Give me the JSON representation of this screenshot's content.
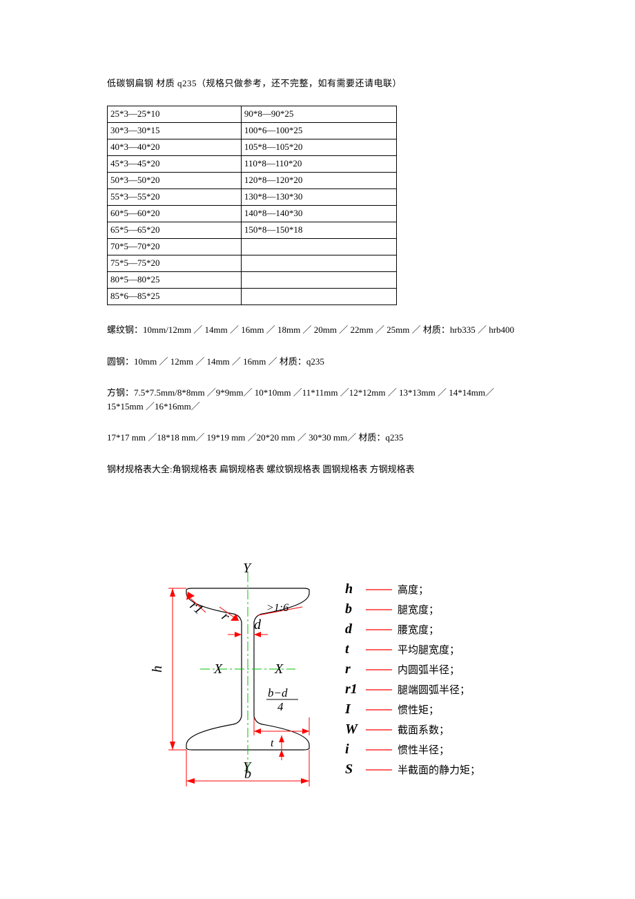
{
  "title": "低碳钢扁钢 材质 q235（规格只做参考，还不完整，如有需要还请电联）",
  "table": {
    "rows": [
      [
        "25*3—25*10",
        "90*8—90*25"
      ],
      [
        "30*3—30*15",
        "100*6—100*25"
      ],
      [
        "40*3—40*20",
        "105*8—105*20"
      ],
      [
        "45*3—45*20",
        "110*8—110*20"
      ],
      [
        "50*3—50*20",
        "120*8—120*20"
      ],
      [
        "55*3—55*20",
        "130*8—130*30"
      ],
      [
        "60*5—60*20",
        "140*8—140*30"
      ],
      [
        "65*5—65*20",
        "150*8—150*18"
      ],
      [
        "70*5—70*20",
        ""
      ],
      [
        "75*5—75*20",
        ""
      ],
      [
        "80*5—80*25",
        ""
      ],
      [
        "85*6—85*25",
        ""
      ]
    ]
  },
  "para1": "螺纹钢：10mm/12mm ／ 14mm ／ 16mm ／ 18mm ／ 20mm ／ 22mm ／ 25mm ／ 材质：hrb335 ／ hrb400",
  "para2": "圆钢：10mm ／ 12mm ／ 14mm ／ 16mm ／ 材质：q235",
  "para3": "方钢：7.5*7.5mm/8*8mm ／9*9mm／ 10*10mm ／11*11mm ／12*12mm ／ 13*13mm ／ 14*14mm／ 15*15mm ／16*16mm／",
  "para4": "17*17 mm ／18*18 mm／ 19*19 mm ／20*20 mm ／ 30*30 mm／ 材质：q235",
  "para5": "钢材规格表大全:角钢规格表 扁钢规格表 螺纹钢规格表 圆钢规格表 方钢规格表",
  "diagram": {
    "Y": "Y",
    "X": "X",
    "r1": "r1",
    "r": "r",
    "slope": ">1:6",
    "d": "d",
    "h": "h",
    "b": "b",
    "t": "t",
    "bd4_top": "b−d",
    "bd4_bot": "4",
    "legend": [
      {
        "sym": "h",
        "dash": "——",
        "cn": "高度；"
      },
      {
        "sym": "b",
        "dash": "——",
        "cn": "腿宽度；"
      },
      {
        "sym": "d",
        "dash": "——",
        "cn": "腰宽度；"
      },
      {
        "sym": "t",
        "dash": "——",
        "cn": "平均腿宽度；"
      },
      {
        "sym": "r",
        "dash": "——",
        "cn": "内圆弧半径；"
      },
      {
        "sym": "r1",
        "dash": "——",
        "cn": "腿端圆弧半径；"
      },
      {
        "sym": "I",
        "dash": "——",
        "cn": "惯性矩；"
      },
      {
        "sym": "W",
        "dash": "——",
        "cn": "截面系数；"
      },
      {
        "sym": "i",
        "dash": "——",
        "cn": "惯性半径；"
      },
      {
        "sym": "S",
        "dash": "——",
        "cn": "半截面的静力矩；"
      }
    ]
  }
}
